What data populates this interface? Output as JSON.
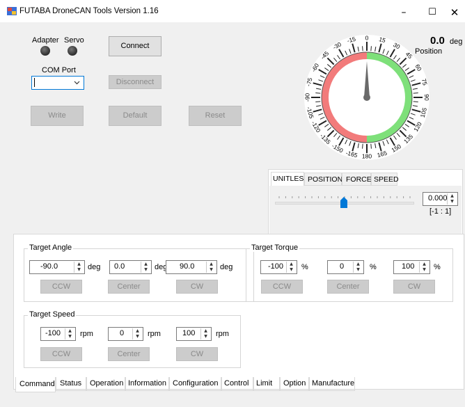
{
  "window": {
    "title": "FUTABA DroneCAN Tools   Version 1.16",
    "minimize_glyph": "–",
    "maximize_glyph": "☐",
    "close_glyph": "✕"
  },
  "top": {
    "adapter_label": "Adapter",
    "servo_label": "Servo",
    "com_port_label": "COM Port",
    "com_port_value": "",
    "connect_label": "Connect",
    "disconnect_label": "Disconnect",
    "write_label": "Write",
    "default_label": "Default",
    "reset_label": "Reset"
  },
  "gauge": {
    "value": "0.0",
    "unit": "deg",
    "caption": "Position",
    "angle_deg": 0,
    "ticks": [
      "0",
      "15",
      "30",
      "45",
      "60",
      "75",
      "90",
      "105",
      "120",
      "135",
      "150",
      "165",
      "180",
      "-165",
      "-150",
      "-135",
      "-120",
      "-105",
      "-90",
      "-75",
      "-60",
      "-45",
      "-30",
      "-15"
    ]
  },
  "mode_tabs": [
    "UNITLESS",
    "POSITION",
    "FORCE",
    "SPEED"
  ],
  "slider": {
    "value": "0.000",
    "range": "[-1 : 1]",
    "fraction": 0.5
  },
  "target_angle": {
    "title": "Target Angle",
    "ccw_value": "-90.0",
    "center_value": "0.0",
    "cw_value": "90.0",
    "unit": "deg",
    "ccw_label": "CCW",
    "center_label": "Center",
    "cw_label": "CW"
  },
  "target_torque": {
    "title": "Target Torque",
    "ccw_value": "-100",
    "center_value": "0",
    "cw_value": "100",
    "unit": "%",
    "ccw_label": "CCW",
    "center_label": "Center",
    "cw_label": "CW"
  },
  "target_speed": {
    "title": "Target Speed",
    "ccw_value": "-100",
    "center_value": "0",
    "cw_value": "100",
    "unit": "rpm",
    "ccw_label": "CCW",
    "center_label": "Center",
    "cw_label": "CW"
  },
  "bottom_tabs": [
    "Command",
    "Status",
    "Operation",
    "Information",
    "Configuration",
    "Control",
    "Limit",
    "Option",
    "Manufacture"
  ]
}
